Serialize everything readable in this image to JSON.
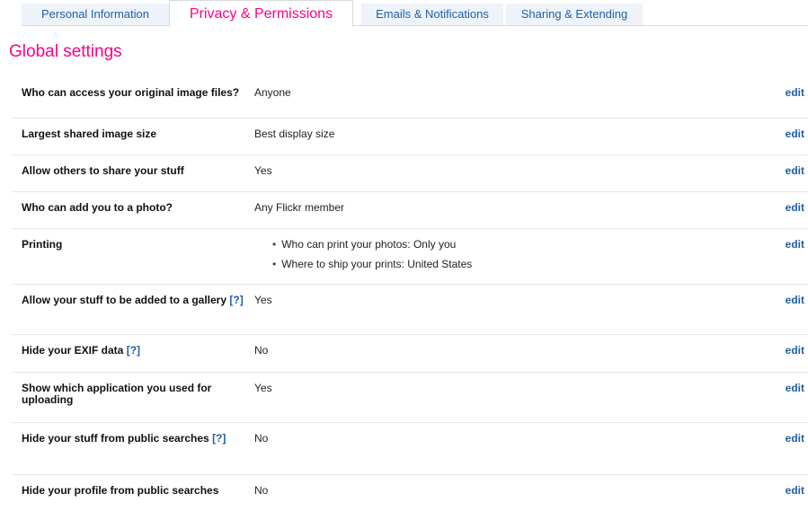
{
  "tabs": [
    {
      "label": "Personal Information"
    },
    {
      "label": "Privacy & Permissions"
    },
    {
      "label": "Emails & Notifications"
    },
    {
      "label": "Sharing & Extending"
    }
  ],
  "section": {
    "title": "Global settings"
  },
  "settings": [
    {
      "label": "Who can access your original image files?",
      "value": "Anyone",
      "edit": "edit"
    },
    {
      "label": "Largest shared image size",
      "value": "Best display size",
      "edit": "edit"
    },
    {
      "label": "Allow others to share your stuff",
      "value": "Yes",
      "edit": "edit"
    },
    {
      "label": "Who can add you to a photo?",
      "value": "Any Flickr member",
      "edit": "edit"
    },
    {
      "label": "Printing",
      "bullets": [
        "Who can print your photos: Only you",
        "Where to ship your prints: United States"
      ],
      "edit": "edit"
    },
    {
      "label": "Allow your stuff to be added to a gallery",
      "help": "[?]",
      "value": "Yes",
      "edit": "edit"
    },
    {
      "label": "Hide your EXIF data",
      "help": "[?]",
      "value": "No",
      "edit": "edit"
    },
    {
      "label": "Show which application you used for uploading",
      "value": "Yes",
      "edit": "edit"
    },
    {
      "label": "Hide your stuff from public searches",
      "help": "[?]",
      "value": "No",
      "edit": "edit"
    },
    {
      "label": "Hide your profile from public searches",
      "value": "No",
      "edit": "edit"
    }
  ]
}
